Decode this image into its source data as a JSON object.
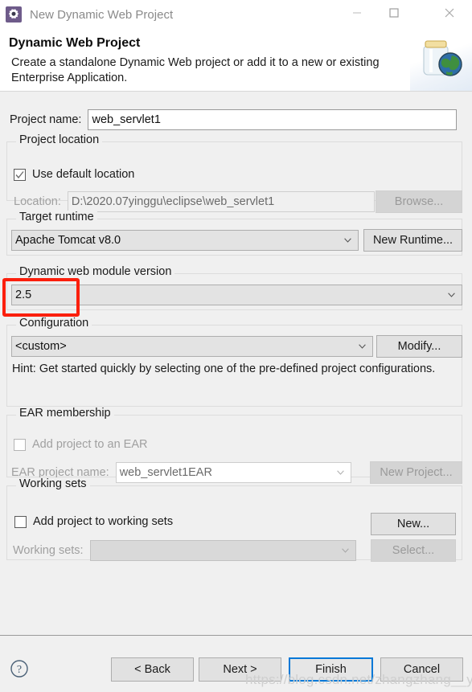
{
  "window": {
    "title": "New Dynamic Web Project",
    "icon": "eclipse-gear-icon",
    "minimize_label": "─",
    "maximize_label": "□",
    "close_label": "✕"
  },
  "header": {
    "title": "Dynamic Web Project",
    "description": "Create a standalone Dynamic Web project or add it to a new or existing Enterprise Application.",
    "banner_icon": "jar-with-globe-icon"
  },
  "project_name": {
    "label": "Project name:",
    "value": "web_servlet1"
  },
  "project_location": {
    "legend": "Project location",
    "use_default_label": "Use default location",
    "use_default_checked": true,
    "location_label": "Location:",
    "location_value": "D:\\2020.07yinggu\\eclipse\\web_servlet1",
    "browse_label": "Browse...",
    "browse_enabled": false
  },
  "target_runtime": {
    "legend": "Target runtime",
    "value": "Apache Tomcat v8.0",
    "new_runtime_label": "New Runtime..."
  },
  "module_version": {
    "legend": "Dynamic web module version",
    "value": "2.5",
    "highlighted": true
  },
  "configuration": {
    "legend": "Configuration",
    "value": "<custom>",
    "modify_label": "Modify...",
    "hint": "Hint: Get started quickly by selecting one of the pre-defined project configurations."
  },
  "ear_membership": {
    "legend": "EAR membership",
    "add_to_ear_label": "Add project to an EAR",
    "add_to_ear_checked": false,
    "ear_project_label": "EAR project name:",
    "ear_project_value": "web_servlet1EAR",
    "new_project_label": "New Project...",
    "new_project_enabled": false
  },
  "working_sets": {
    "legend": "Working sets",
    "add_to_working_sets_label": "Add project to working sets",
    "add_to_working_sets_checked": false,
    "working_sets_label": "Working sets:",
    "working_sets_value": "",
    "new_label": "New...",
    "select_label": "Select...",
    "select_enabled": false
  },
  "footer": {
    "help_icon": "help-question-icon",
    "back_label": "< Back",
    "next_label": "Next >",
    "finish_label": "Finish",
    "cancel_label": "Cancel",
    "default_button": "Finish"
  },
  "watermark": {
    "text": "https://blog.csdn.net/zhangzhang__yan"
  },
  "colors": {
    "dialog_bg": "#f0f0f0",
    "accent_focus": "#0078d7",
    "annotation_red": "#fb1f0d",
    "app_icon_purple": "#6e5b8a"
  }
}
